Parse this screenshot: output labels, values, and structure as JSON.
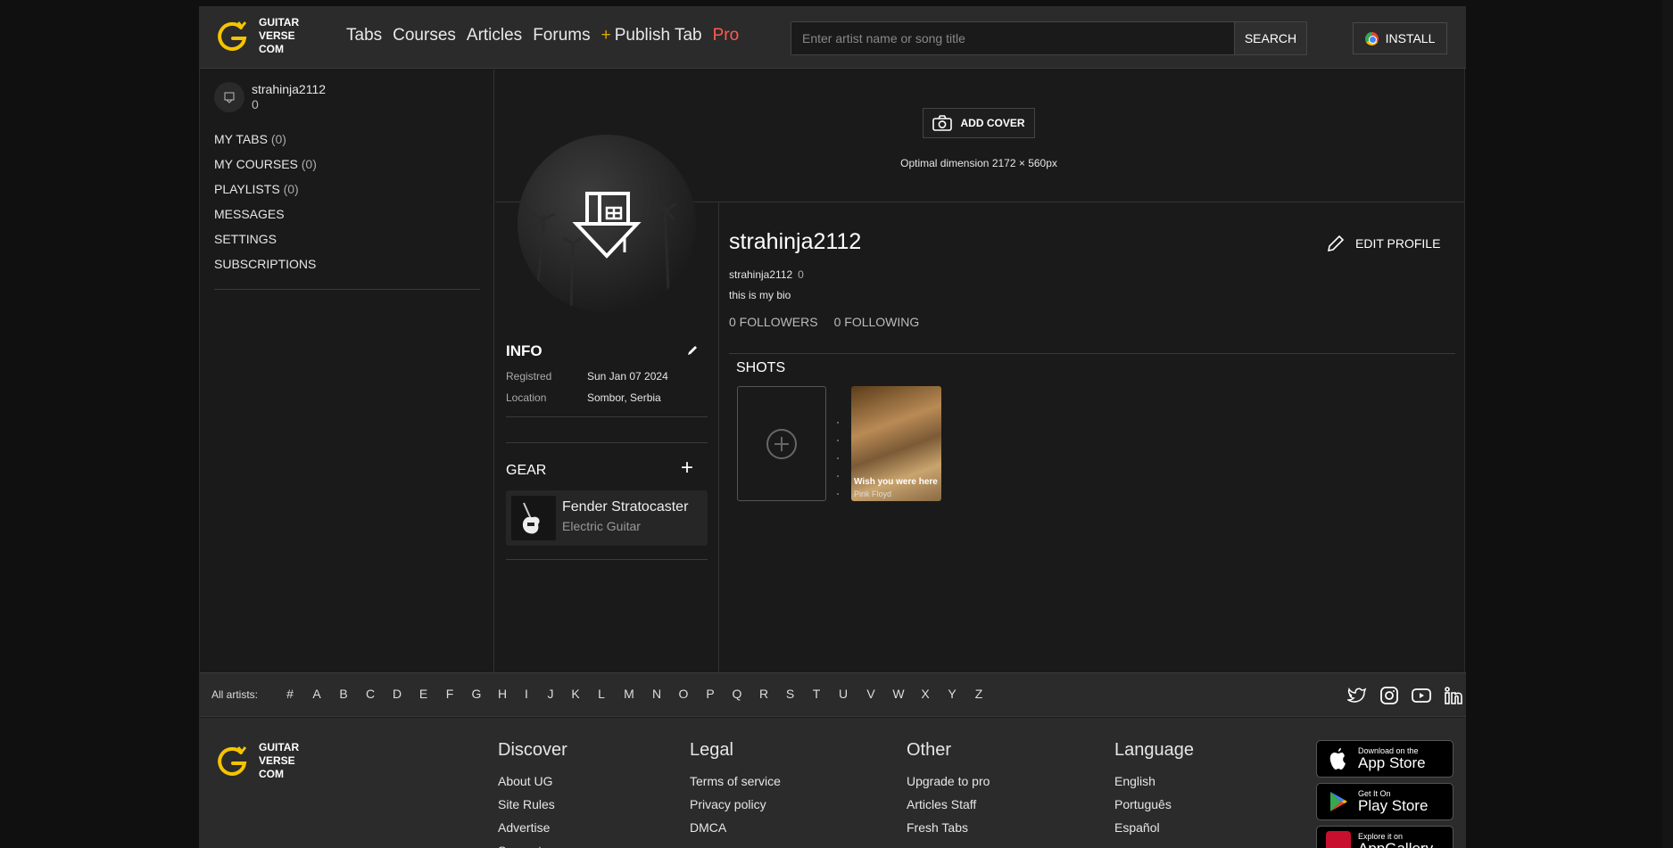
{
  "header": {
    "logo_text": [
      "GUITAR",
      "VERSE",
      "COM"
    ],
    "nav": [
      "Tabs",
      "Courses",
      "Articles",
      "Forums"
    ],
    "publish_plus": "+",
    "publish": "Publish Tab",
    "pro": "Pro",
    "search_placeholder": "Enter artist name or song title",
    "search_label": "SEARCH",
    "install_label": "INSTALL"
  },
  "sidebar": {
    "username": "strahinja2112",
    "reputation": "0",
    "menu": [
      {
        "label": "MY TABS",
        "count": "(0)"
      },
      {
        "label": "MY COURSES",
        "count": "(0)"
      },
      {
        "label": "PLAYLISTS",
        "count": "(0)"
      },
      {
        "label": "MESSAGES",
        "count": ""
      },
      {
        "label": "SETTINGS",
        "count": ""
      },
      {
        "label": "SUBSCRIPTIONS",
        "count": ""
      }
    ]
  },
  "cover": {
    "add_label": "ADD COVER",
    "hint": "Optimal dimension 2172 × 560px"
  },
  "info": {
    "title": "INFO",
    "registered_key": "Registred",
    "registered_val": "Sun Jan 07 2024",
    "location_key": "Location",
    "location_val": "Sombor, Serbia"
  },
  "gear": {
    "title": "GEAR",
    "item_name": "Fender Stratocaster",
    "item_type": "Electric Guitar"
  },
  "profile": {
    "name": "strahinja2112",
    "username": "strahinja2112",
    "reputation": "0",
    "bio": "this is my bio",
    "followers": "0 FOLLOWERS",
    "following": "0 FOLLOWING",
    "edit_label": "EDIT PROFILE",
    "shots_title": "SHOTS",
    "shot_caption": "Wish you were here",
    "shot_sub": "Pink Floyd"
  },
  "artists": {
    "label": "All artists:",
    "letters": [
      "#",
      "A",
      "B",
      "C",
      "D",
      "E",
      "F",
      "G",
      "H",
      "I",
      "J",
      "K",
      "L",
      "M",
      "N",
      "O",
      "P",
      "Q",
      "R",
      "S",
      "T",
      "U",
      "V",
      "W",
      "X",
      "Y",
      "Z"
    ]
  },
  "footer": {
    "discover": {
      "title": "Discover",
      "items": [
        "About UG",
        "Site Rules",
        "Advertise",
        "Support"
      ]
    },
    "legal": {
      "title": "Legal",
      "items": [
        "Terms of service",
        "Privacy policy",
        "DMCA"
      ]
    },
    "other": {
      "title": "Other",
      "items": [
        "Upgrade to pro",
        "Articles Staff",
        "Fresh Tabs"
      ]
    },
    "language": {
      "title": "Language",
      "items": [
        "English",
        "Português",
        "Español"
      ]
    },
    "stores": [
      {
        "small": "Download on the",
        "big": "App Store",
        "icon": "apple-icon"
      },
      {
        "small": "Get It On",
        "big": "Play Store",
        "icon": "play-icon"
      },
      {
        "small": "Explore it on",
        "big": "AppGallery",
        "icon": "huawei-icon"
      }
    ]
  },
  "colors": {
    "accent": "#f5c400",
    "pro": "#ff5a4e",
    "plus": "#e0a800"
  }
}
